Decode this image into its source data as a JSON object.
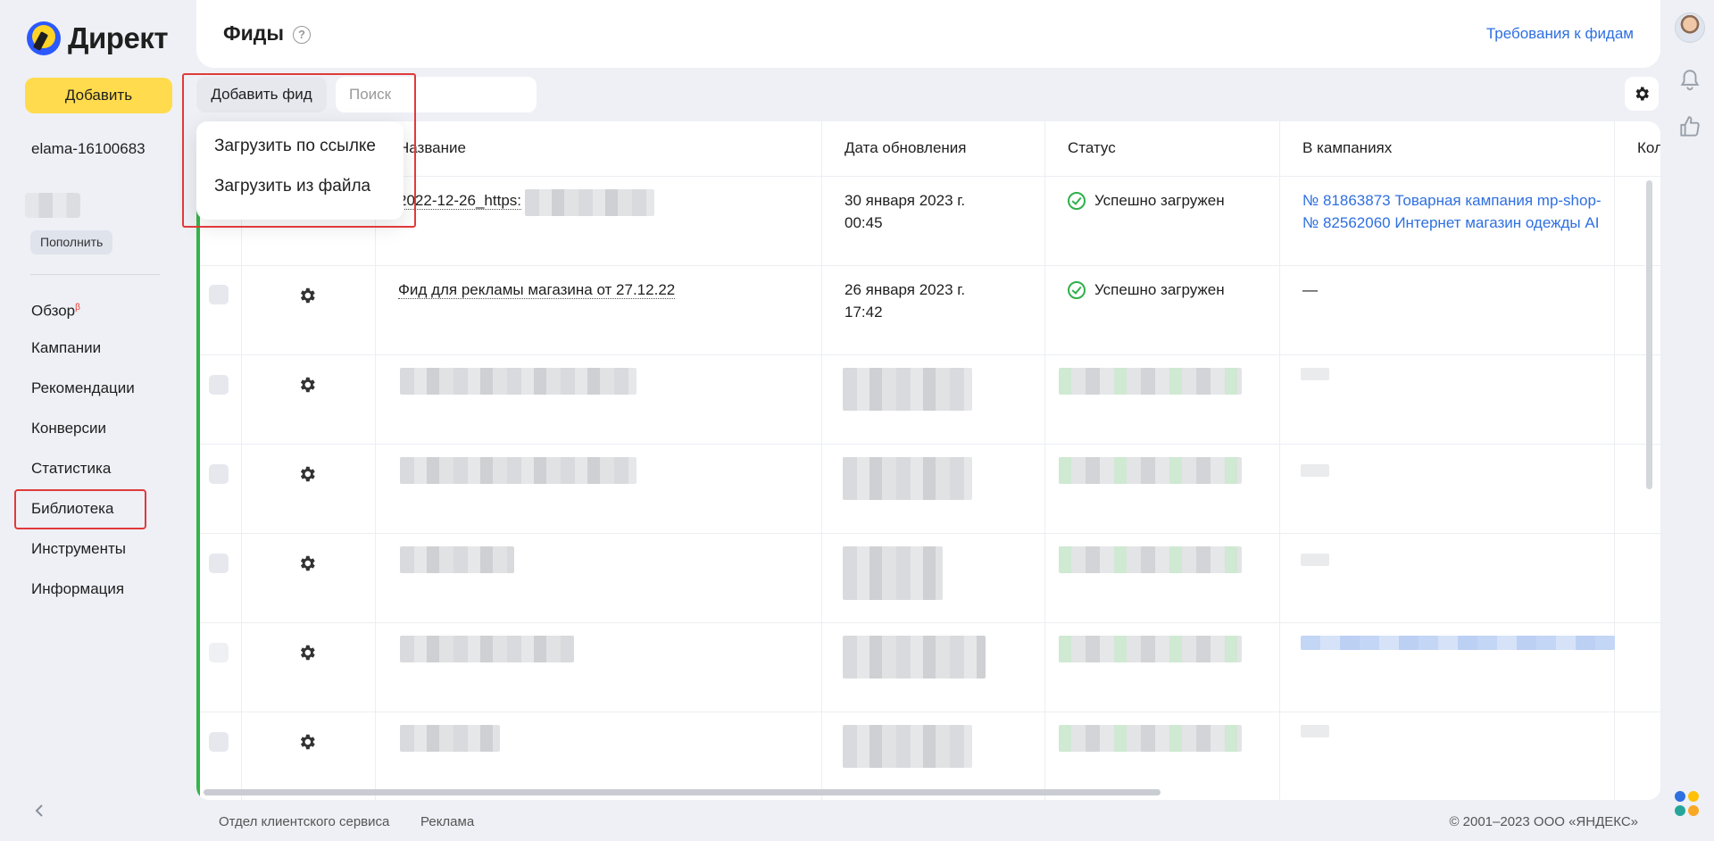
{
  "app": {
    "logo": "Директ",
    "add_button": "Добавить"
  },
  "account": {
    "login": "elama-16100683",
    "topup_button": "Пополнить"
  },
  "nav": {
    "items": [
      {
        "label": "Обзор",
        "badge": "β"
      },
      {
        "label": "Кампании"
      },
      {
        "label": "Рекомендации"
      },
      {
        "label": "Конверсии"
      },
      {
        "label": "Статистика"
      },
      {
        "label": "Библиотека"
      },
      {
        "label": "Инструменты"
      },
      {
        "label": "Информация"
      }
    ],
    "highlighted": "Библиотека"
  },
  "header": {
    "title": "Фиды",
    "help": "?",
    "requirements_link": "Требования к фидам"
  },
  "toolbar": {
    "add_feed_label": "Добавить фид",
    "search_placeholder": "Поиск"
  },
  "dropdown": {
    "items": [
      "Загрузить по ссылке",
      "Загрузить из файла"
    ]
  },
  "table": {
    "headers": {
      "name": "Название",
      "updated": "Дата обновления",
      "status": "Статус",
      "campaigns": "В кампаниях",
      "count": "Кол"
    },
    "rows": [
      {
        "name": "2022-12-26_https:",
        "date_line1": "30 января 2023 г.",
        "date_line2": "00:45",
        "status": "Успешно загружен",
        "campaign1": "№ 81863873 Товарная кампания mp-shop-",
        "campaign2": "№ 82562060 Интернет магазин одежды AI"
      },
      {
        "name": "Фид для рекламы магазина от 27.12.22",
        "date_line1": "26 января 2023 г.",
        "date_line2": "17:42",
        "status": "Успешно загружен",
        "campaign1": "—"
      }
    ]
  },
  "footer": {
    "links": [
      "Отдел клиентского сервиса",
      "Реклама"
    ],
    "copyright": "© 2001–2023 ООО «ЯНДЕКС»"
  },
  "colors": {
    "accent_yellow": "#ffdb4d",
    "link_blue": "#2f6fe0",
    "success_green": "#35b54a",
    "highlight_red": "#e03a3a"
  }
}
